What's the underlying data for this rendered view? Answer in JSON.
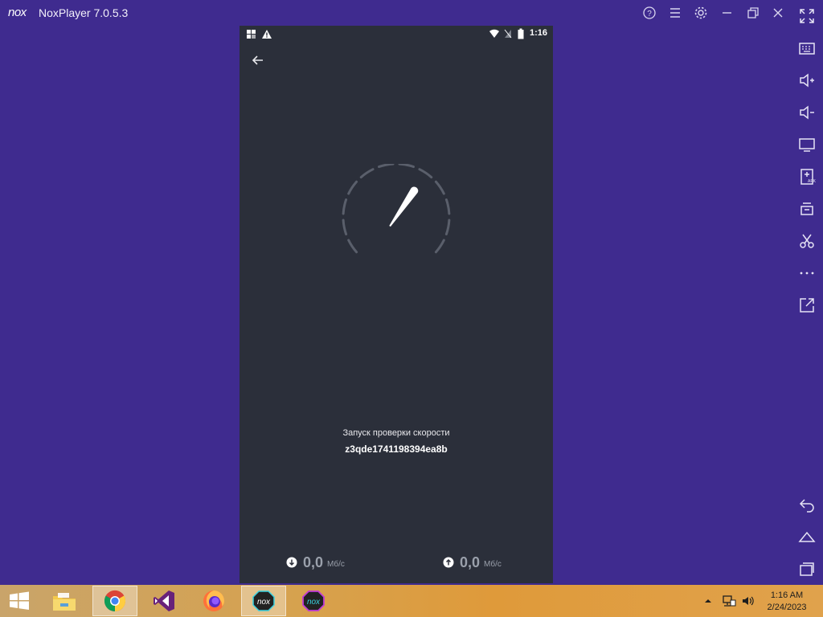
{
  "window": {
    "title": "NoxPlayer 7.0.5.3",
    "title_icons": [
      "help-icon",
      "menu-icon",
      "settings-icon",
      "minimize-icon",
      "restore-icon",
      "close-icon",
      "fullscreen-icon"
    ]
  },
  "sidebar": {
    "tools": [
      "keyboard-icon",
      "volume-up-icon",
      "volume-down-icon",
      "screen-icon",
      "apk-install-icon",
      "multi-instance-icon",
      "screenshot-icon",
      "more-icon",
      "open-external-icon"
    ],
    "nav": [
      "back-icon",
      "home-icon",
      "recent-apps-icon"
    ]
  },
  "android": {
    "status_time": "1:16",
    "status_text": "Запуск проверки скорости",
    "server_id": "z3qde1741198394ea8b",
    "download": {
      "value": "0,0",
      "unit": "Мб/с"
    },
    "upload": {
      "value": "0,0",
      "unit": "Мб/с"
    },
    "gauge_needle_fraction": 0.5
  },
  "taskbar": {
    "apps": [
      "file-explorer-icon",
      "chrome-icon",
      "visual-studio-icon",
      "firefox-icon",
      "nox-icon",
      "nox-multi-icon"
    ],
    "active_apps": [
      "chrome-icon",
      "nox-icon"
    ],
    "clock_time": "1:16 AM",
    "clock_date": "2/24/2023"
  },
  "colors": {
    "background": "#3f2b8f",
    "phone": "#2b2f3a",
    "gauge_track": "#5a5f6b"
  }
}
